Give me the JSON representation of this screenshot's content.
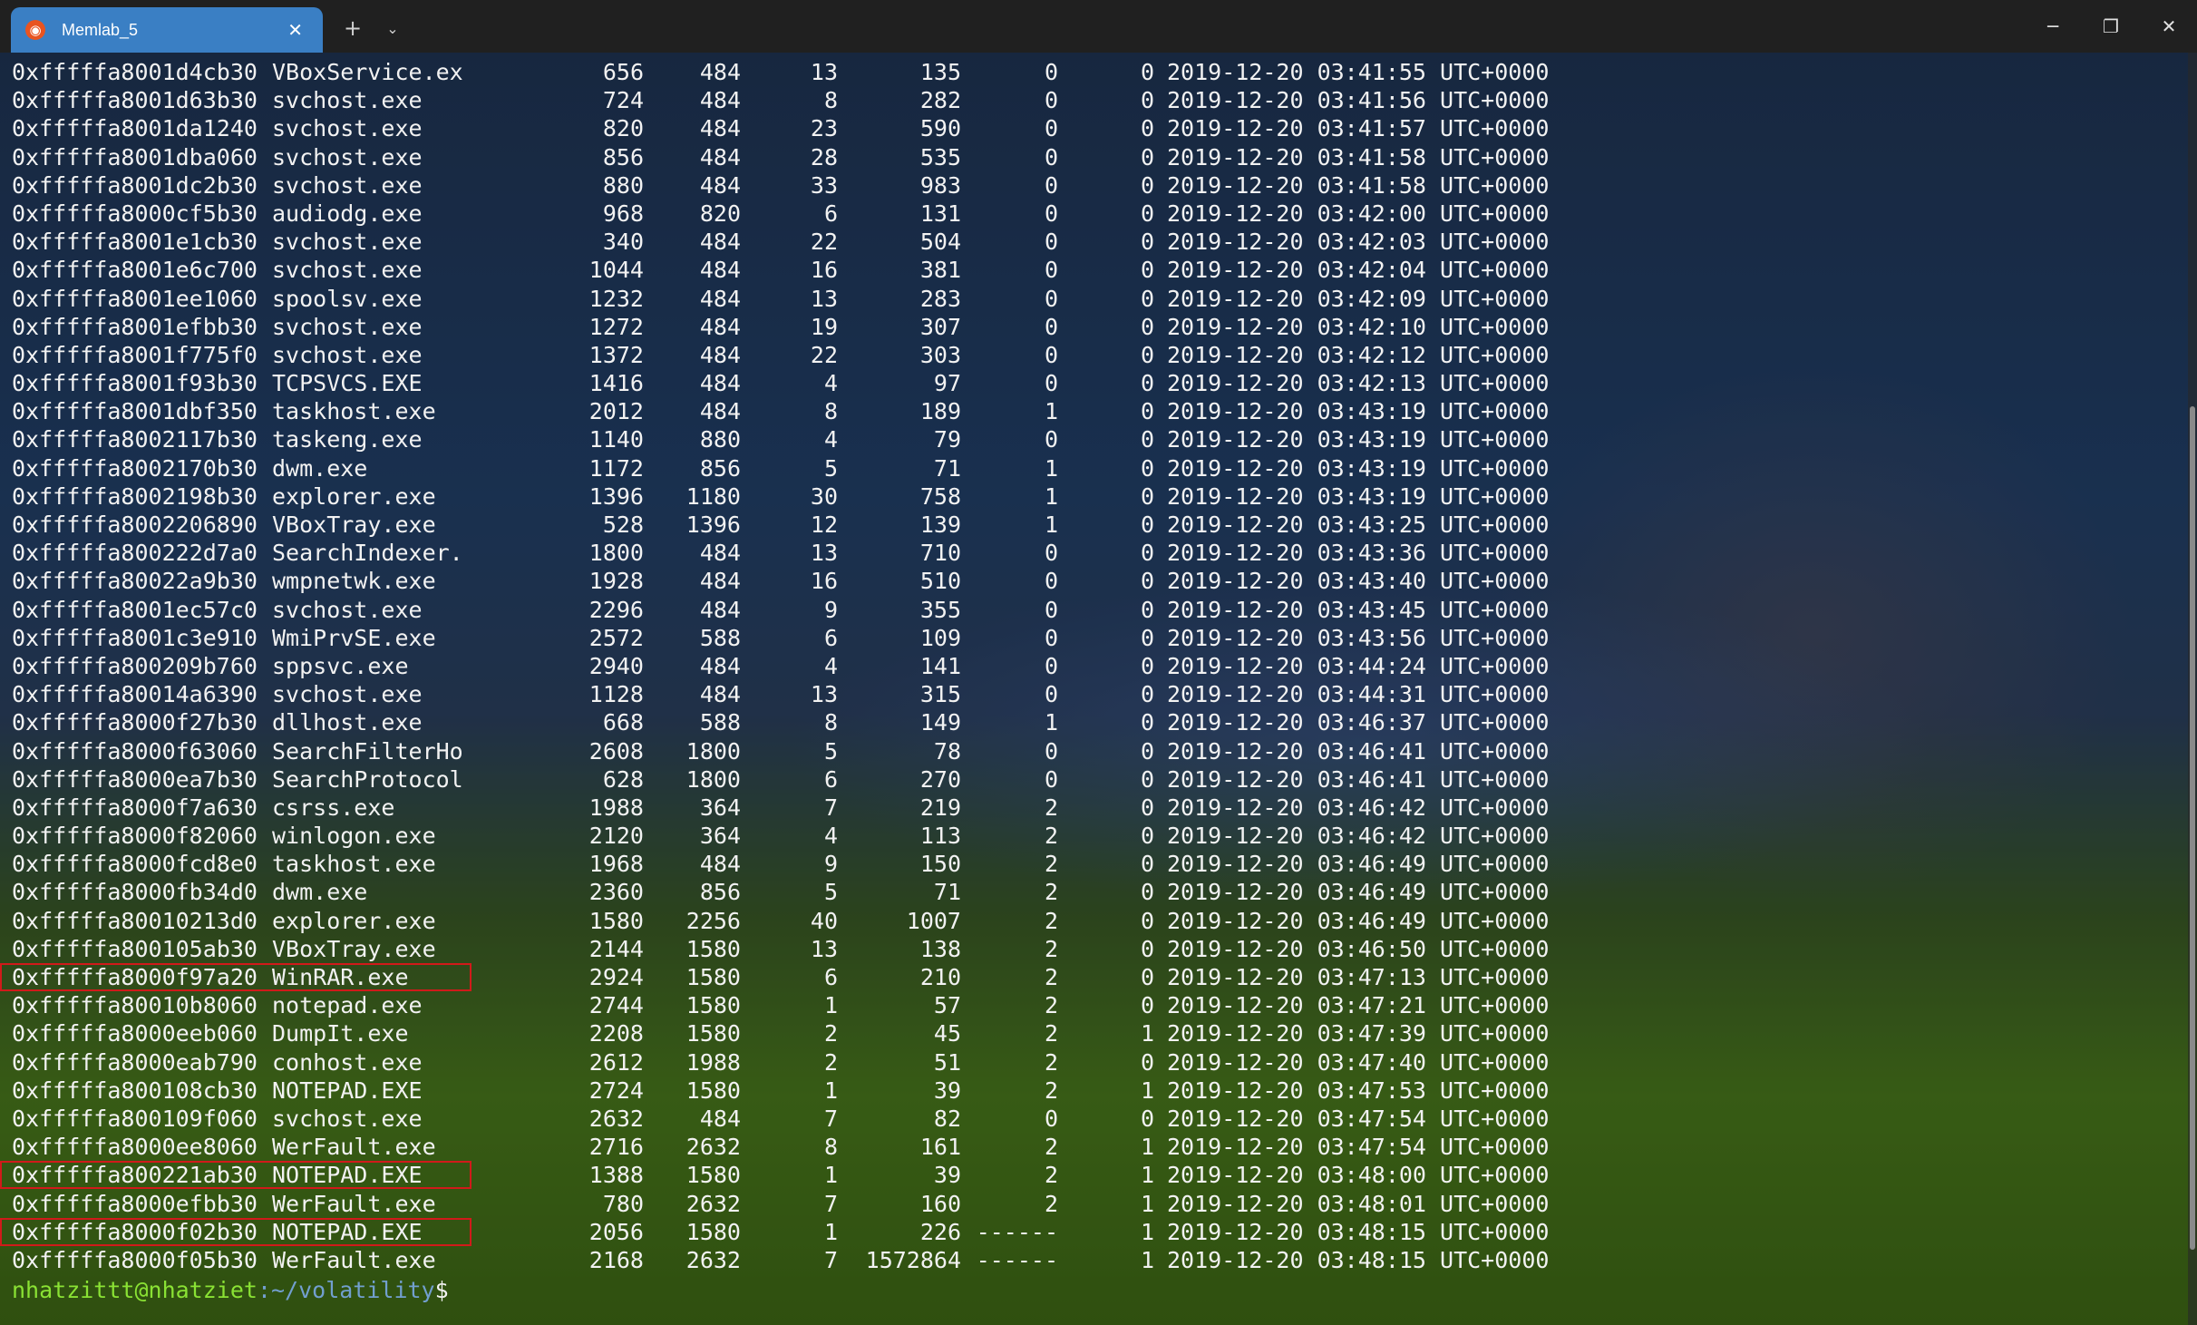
{
  "window": {
    "tab_title": "Memlab_5",
    "tab_icon": "ubuntu-icon",
    "new_tab_symbol": "+",
    "dropdown_symbol": "⌄",
    "minimize_symbol": "─",
    "maximize_symbol": "❐",
    "close_symbol": "✕",
    "tab_close_symbol": "✕"
  },
  "rows": [
    {
      "offset": "0xfffffa8001d4cb30",
      "name": "VBoxService.ex",
      "pid": "656",
      "ppid": "484",
      "thds": "13",
      "hnds": "135",
      "sess": "0",
      "wow64": "0",
      "start": "2019-12-20 03:41:55 UTC+0000",
      "highlight": false
    },
    {
      "offset": "0xfffffa8001d63b30",
      "name": "svchost.exe",
      "pid": "724",
      "ppid": "484",
      "thds": "8",
      "hnds": "282",
      "sess": "0",
      "wow64": "0",
      "start": "2019-12-20 03:41:56 UTC+0000",
      "highlight": false
    },
    {
      "offset": "0xfffffa8001da1240",
      "name": "svchost.exe",
      "pid": "820",
      "ppid": "484",
      "thds": "23",
      "hnds": "590",
      "sess": "0",
      "wow64": "0",
      "start": "2019-12-20 03:41:57 UTC+0000",
      "highlight": false
    },
    {
      "offset": "0xfffffa8001dba060",
      "name": "svchost.exe",
      "pid": "856",
      "ppid": "484",
      "thds": "28",
      "hnds": "535",
      "sess": "0",
      "wow64": "0",
      "start": "2019-12-20 03:41:58 UTC+0000",
      "highlight": false
    },
    {
      "offset": "0xfffffa8001dc2b30",
      "name": "svchost.exe",
      "pid": "880",
      "ppid": "484",
      "thds": "33",
      "hnds": "983",
      "sess": "0",
      "wow64": "0",
      "start": "2019-12-20 03:41:58 UTC+0000",
      "highlight": false
    },
    {
      "offset": "0xfffffa8000cf5b30",
      "name": "audiodg.exe",
      "pid": "968",
      "ppid": "820",
      "thds": "6",
      "hnds": "131",
      "sess": "0",
      "wow64": "0",
      "start": "2019-12-20 03:42:00 UTC+0000",
      "highlight": false
    },
    {
      "offset": "0xfffffa8001e1cb30",
      "name": "svchost.exe",
      "pid": "340",
      "ppid": "484",
      "thds": "22",
      "hnds": "504",
      "sess": "0",
      "wow64": "0",
      "start": "2019-12-20 03:42:03 UTC+0000",
      "highlight": false
    },
    {
      "offset": "0xfffffa8001e6c700",
      "name": "svchost.exe",
      "pid": "1044",
      "ppid": "484",
      "thds": "16",
      "hnds": "381",
      "sess": "0",
      "wow64": "0",
      "start": "2019-12-20 03:42:04 UTC+0000",
      "highlight": false
    },
    {
      "offset": "0xfffffa8001ee1060",
      "name": "spoolsv.exe",
      "pid": "1232",
      "ppid": "484",
      "thds": "13",
      "hnds": "283",
      "sess": "0",
      "wow64": "0",
      "start": "2019-12-20 03:42:09 UTC+0000",
      "highlight": false
    },
    {
      "offset": "0xfffffa8001efbb30",
      "name": "svchost.exe",
      "pid": "1272",
      "ppid": "484",
      "thds": "19",
      "hnds": "307",
      "sess": "0",
      "wow64": "0",
      "start": "2019-12-20 03:42:10 UTC+0000",
      "highlight": false
    },
    {
      "offset": "0xfffffa8001f775f0",
      "name": "svchost.exe",
      "pid": "1372",
      "ppid": "484",
      "thds": "22",
      "hnds": "303",
      "sess": "0",
      "wow64": "0",
      "start": "2019-12-20 03:42:12 UTC+0000",
      "highlight": false
    },
    {
      "offset": "0xfffffa8001f93b30",
      "name": "TCPSVCS.EXE",
      "pid": "1416",
      "ppid": "484",
      "thds": "4",
      "hnds": "97",
      "sess": "0",
      "wow64": "0",
      "start": "2019-12-20 03:42:13 UTC+0000",
      "highlight": false
    },
    {
      "offset": "0xfffffa8001dbf350",
      "name": "taskhost.exe",
      "pid": "2012",
      "ppid": "484",
      "thds": "8",
      "hnds": "189",
      "sess": "1",
      "wow64": "0",
      "start": "2019-12-20 03:43:19 UTC+0000",
      "highlight": false
    },
    {
      "offset": "0xfffffa8002117b30",
      "name": "taskeng.exe",
      "pid": "1140",
      "ppid": "880",
      "thds": "4",
      "hnds": "79",
      "sess": "0",
      "wow64": "0",
      "start": "2019-12-20 03:43:19 UTC+0000",
      "highlight": false
    },
    {
      "offset": "0xfffffa8002170b30",
      "name": "dwm.exe",
      "pid": "1172",
      "ppid": "856",
      "thds": "5",
      "hnds": "71",
      "sess": "1",
      "wow64": "0",
      "start": "2019-12-20 03:43:19 UTC+0000",
      "highlight": false
    },
    {
      "offset": "0xfffffa8002198b30",
      "name": "explorer.exe",
      "pid": "1396",
      "ppid": "1180",
      "thds": "30",
      "hnds": "758",
      "sess": "1",
      "wow64": "0",
      "start": "2019-12-20 03:43:19 UTC+0000",
      "highlight": false
    },
    {
      "offset": "0xfffffa8002206890",
      "name": "VBoxTray.exe",
      "pid": "528",
      "ppid": "1396",
      "thds": "12",
      "hnds": "139",
      "sess": "1",
      "wow64": "0",
      "start": "2019-12-20 03:43:25 UTC+0000",
      "highlight": false
    },
    {
      "offset": "0xfffffa800222d7a0",
      "name": "SearchIndexer.",
      "pid": "1800",
      "ppid": "484",
      "thds": "13",
      "hnds": "710",
      "sess": "0",
      "wow64": "0",
      "start": "2019-12-20 03:43:36 UTC+0000",
      "highlight": false
    },
    {
      "offset": "0xfffffa80022a9b30",
      "name": "wmpnetwk.exe",
      "pid": "1928",
      "ppid": "484",
      "thds": "16",
      "hnds": "510",
      "sess": "0",
      "wow64": "0",
      "start": "2019-12-20 03:43:40 UTC+0000",
      "highlight": false
    },
    {
      "offset": "0xfffffa8001ec57c0",
      "name": "svchost.exe",
      "pid": "2296",
      "ppid": "484",
      "thds": "9",
      "hnds": "355",
      "sess": "0",
      "wow64": "0",
      "start": "2019-12-20 03:43:45 UTC+0000",
      "highlight": false
    },
    {
      "offset": "0xfffffa8001c3e910",
      "name": "WmiPrvSE.exe",
      "pid": "2572",
      "ppid": "588",
      "thds": "6",
      "hnds": "109",
      "sess": "0",
      "wow64": "0",
      "start": "2019-12-20 03:43:56 UTC+0000",
      "highlight": false
    },
    {
      "offset": "0xfffffa800209b760",
      "name": "sppsvc.exe",
      "pid": "2940",
      "ppid": "484",
      "thds": "4",
      "hnds": "141",
      "sess": "0",
      "wow64": "0",
      "start": "2019-12-20 03:44:24 UTC+0000",
      "highlight": false
    },
    {
      "offset": "0xfffffa80014a6390",
      "name": "svchost.exe",
      "pid": "1128",
      "ppid": "484",
      "thds": "13",
      "hnds": "315",
      "sess": "0",
      "wow64": "0",
      "start": "2019-12-20 03:44:31 UTC+0000",
      "highlight": false
    },
    {
      "offset": "0xfffffa8000f27b30",
      "name": "dllhost.exe",
      "pid": "668",
      "ppid": "588",
      "thds": "8",
      "hnds": "149",
      "sess": "1",
      "wow64": "0",
      "start": "2019-12-20 03:46:37 UTC+0000",
      "highlight": false
    },
    {
      "offset": "0xfffffa8000f63060",
      "name": "SearchFilterHo",
      "pid": "2608",
      "ppid": "1800",
      "thds": "5",
      "hnds": "78",
      "sess": "0",
      "wow64": "0",
      "start": "2019-12-20 03:46:41 UTC+0000",
      "highlight": false
    },
    {
      "offset": "0xfffffa8000ea7b30",
      "name": "SearchProtocol",
      "pid": "628",
      "ppid": "1800",
      "thds": "6",
      "hnds": "270",
      "sess": "0",
      "wow64": "0",
      "start": "2019-12-20 03:46:41 UTC+0000",
      "highlight": false
    },
    {
      "offset": "0xfffffa8000f7a630",
      "name": "csrss.exe",
      "pid": "1988",
      "ppid": "364",
      "thds": "7",
      "hnds": "219",
      "sess": "2",
      "wow64": "0",
      "start": "2019-12-20 03:46:42 UTC+0000",
      "highlight": false
    },
    {
      "offset": "0xfffffa8000f82060",
      "name": "winlogon.exe",
      "pid": "2120",
      "ppid": "364",
      "thds": "4",
      "hnds": "113",
      "sess": "2",
      "wow64": "0",
      "start": "2019-12-20 03:46:42 UTC+0000",
      "highlight": false
    },
    {
      "offset": "0xfffffa8000fcd8e0",
      "name": "taskhost.exe",
      "pid": "1968",
      "ppid": "484",
      "thds": "9",
      "hnds": "150",
      "sess": "2",
      "wow64": "0",
      "start": "2019-12-20 03:46:49 UTC+0000",
      "highlight": false
    },
    {
      "offset": "0xfffffa8000fb34d0",
      "name": "dwm.exe",
      "pid": "2360",
      "ppid": "856",
      "thds": "5",
      "hnds": "71",
      "sess": "2",
      "wow64": "0",
      "start": "2019-12-20 03:46:49 UTC+0000",
      "highlight": false
    },
    {
      "offset": "0xfffffa80010213d0",
      "name": "explorer.exe",
      "pid": "1580",
      "ppid": "2256",
      "thds": "40",
      "hnds": "1007",
      "sess": "2",
      "wow64": "0",
      "start": "2019-12-20 03:46:49 UTC+0000",
      "highlight": false
    },
    {
      "offset": "0xfffffa800105ab30",
      "name": "VBoxTray.exe",
      "pid": "2144",
      "ppid": "1580",
      "thds": "13",
      "hnds": "138",
      "sess": "2",
      "wow64": "0",
      "start": "2019-12-20 03:46:50 UTC+0000",
      "highlight": false
    },
    {
      "offset": "0xfffffa8000f97a20",
      "name": "WinRAR.exe",
      "pid": "2924",
      "ppid": "1580",
      "thds": "6",
      "hnds": "210",
      "sess": "2",
      "wow64": "0",
      "start": "2019-12-20 03:47:13 UTC+0000",
      "highlight": true
    },
    {
      "offset": "0xfffffa80010b8060",
      "name": "notepad.exe",
      "pid": "2744",
      "ppid": "1580",
      "thds": "1",
      "hnds": "57",
      "sess": "2",
      "wow64": "0",
      "start": "2019-12-20 03:47:21 UTC+0000",
      "highlight": false
    },
    {
      "offset": "0xfffffa8000eeb060",
      "name": "DumpIt.exe",
      "pid": "2208",
      "ppid": "1580",
      "thds": "2",
      "hnds": "45",
      "sess": "2",
      "wow64": "1",
      "start": "2019-12-20 03:47:39 UTC+0000",
      "highlight": false
    },
    {
      "offset": "0xfffffa8000eab790",
      "name": "conhost.exe",
      "pid": "2612",
      "ppid": "1988",
      "thds": "2",
      "hnds": "51",
      "sess": "2",
      "wow64": "0",
      "start": "2019-12-20 03:47:40 UTC+0000",
      "highlight": false
    },
    {
      "offset": "0xfffffa800108cb30",
      "name": "NOTEPAD.EXE",
      "pid": "2724",
      "ppid": "1580",
      "thds": "1",
      "hnds": "39",
      "sess": "2",
      "wow64": "1",
      "start": "2019-12-20 03:47:53 UTC+0000",
      "highlight": false
    },
    {
      "offset": "0xfffffa800109f060",
      "name": "svchost.exe",
      "pid": "2632",
      "ppid": "484",
      "thds": "7",
      "hnds": "82",
      "sess": "0",
      "wow64": "0",
      "start": "2019-12-20 03:47:54 UTC+0000",
      "highlight": false
    },
    {
      "offset": "0xfffffa8000ee8060",
      "name": "WerFault.exe",
      "pid": "2716",
      "ppid": "2632",
      "thds": "8",
      "hnds": "161",
      "sess": "2",
      "wow64": "1",
      "start": "2019-12-20 03:47:54 UTC+0000",
      "highlight": false
    },
    {
      "offset": "0xfffffa800221ab30",
      "name": "NOTEPAD.EXE",
      "pid": "1388",
      "ppid": "1580",
      "thds": "1",
      "hnds": "39",
      "sess": "2",
      "wow64": "1",
      "start": "2019-12-20 03:48:00 UTC+0000",
      "highlight": true
    },
    {
      "offset": "0xfffffa8000efbb30",
      "name": "WerFault.exe",
      "pid": "780",
      "ppid": "2632",
      "thds": "7",
      "hnds": "160",
      "sess": "2",
      "wow64": "1",
      "start": "2019-12-20 03:48:01 UTC+0000",
      "highlight": false
    },
    {
      "offset": "0xfffffa8000f02b30",
      "name": "NOTEPAD.EXE",
      "pid": "2056",
      "ppid": "1580",
      "thds": "1",
      "hnds": "226",
      "sess": "------",
      "wow64": "1",
      "start": "2019-12-20 03:48:15 UTC+0000",
      "highlight": true
    },
    {
      "offset": "0xfffffa8000f05b30",
      "name": "WerFault.exe",
      "pid": "2168",
      "ppid": "2632",
      "thds": "7",
      "hnds": "1572864",
      "sess": "------",
      "wow64": "1",
      "start": "2019-12-20 03:48:15 UTC+0000",
      "highlight": false
    }
  ],
  "prompt": {
    "user_host": "nhatzittt@nhatziet",
    "path": ":~/volatility",
    "symbol": "$"
  },
  "colors": {
    "highlight_box": "#d11a1a",
    "tab_bg": "#3a7fc4",
    "prompt_user": "#8ae234",
    "prompt_path": "#729fcf"
  }
}
